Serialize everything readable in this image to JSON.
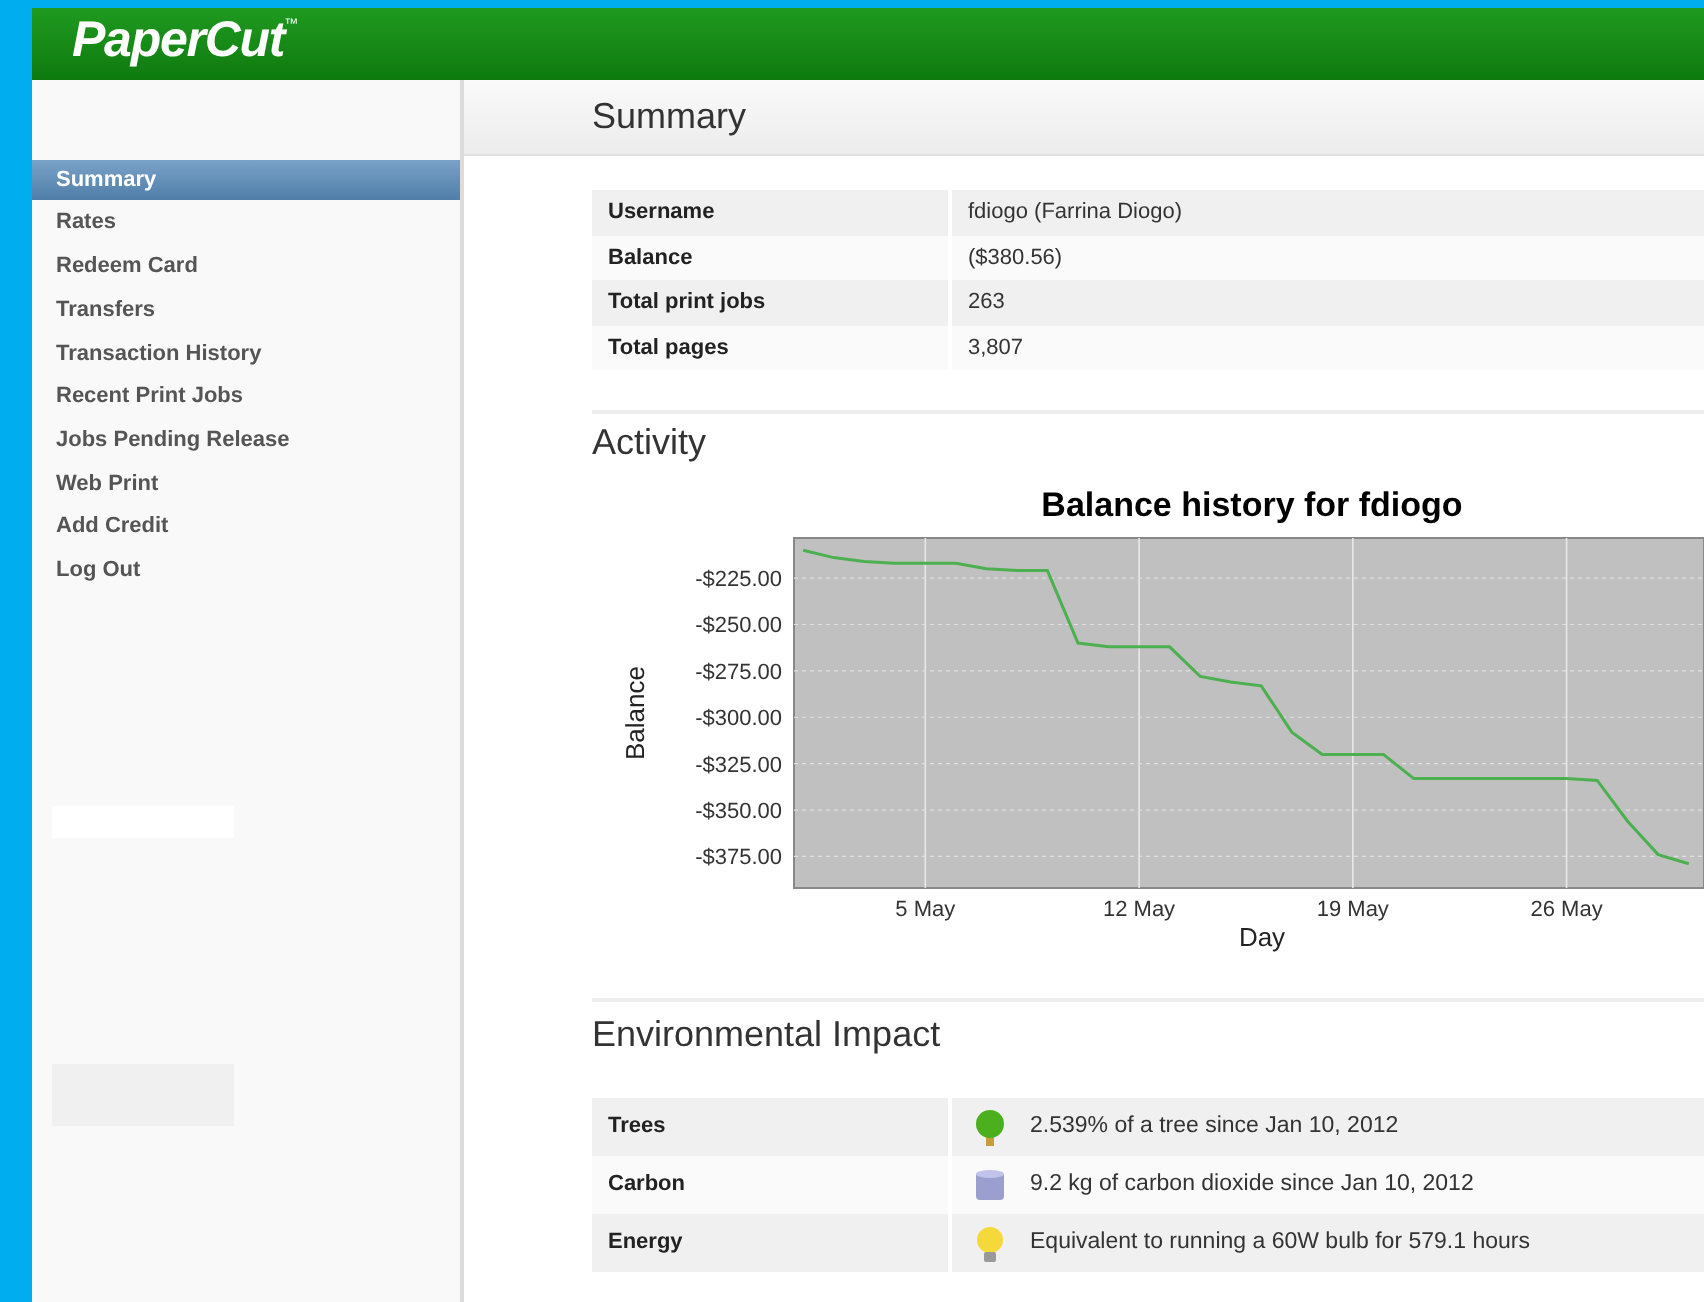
{
  "header": {
    "logo": "PaperCut",
    "trademark": "™"
  },
  "sidebar": {
    "items": [
      {
        "label": "Summary",
        "selected": true
      },
      {
        "label": "Rates",
        "selected": false
      },
      {
        "label": "Redeem Card",
        "selected": false
      },
      {
        "label": "Transfers",
        "selected": false
      },
      {
        "label": "Transaction History",
        "selected": false
      },
      {
        "label": "Recent Print Jobs",
        "selected": false
      },
      {
        "label": "Jobs Pending Release",
        "selected": false
      },
      {
        "label": "Web Print",
        "selected": false
      },
      {
        "label": "Add Credit",
        "selected": false
      },
      {
        "label": "Log Out",
        "selected": false
      }
    ]
  },
  "page_title": "Summary",
  "summary": [
    {
      "label": "Username",
      "value": "fdiogo (Farrina Diogo)"
    },
    {
      "label": "Balance",
      "value": "($380.56)"
    },
    {
      "label": "Total print jobs",
      "value": "263"
    },
    {
      "label": "Total pages",
      "value": "3,807"
    }
  ],
  "activity": {
    "heading": "Activity",
    "chart_data": {
      "type": "line",
      "grid": true,
      "title": "Balance history for fdiogo",
      "xlabel": "Day",
      "ylabel": "Balance",
      "ylim": [
        -392,
        -203.4
      ],
      "categories": [
        null,
        null,
        null,
        null,
        "5 May",
        null,
        null,
        null,
        null,
        null,
        null,
        "12 May",
        null,
        null,
        null,
        null,
        null,
        null,
        "19 May",
        null,
        null,
        null,
        null,
        null,
        null,
        "26 May",
        null,
        null,
        null,
        null
      ],
      "yticks": [
        {
          "value": -225,
          "label": "-$225.00"
        },
        {
          "value": -250,
          "label": "-$250.00"
        },
        {
          "value": -275,
          "label": "-$275.00"
        },
        {
          "value": -300,
          "label": "-$300.00"
        },
        {
          "value": -325,
          "label": "-$325.00"
        },
        {
          "value": -350,
          "label": "-$350.00"
        },
        {
          "value": -375,
          "label": "-$375.00"
        }
      ],
      "series": [
        {
          "color": "#4caf50",
          "values": [
            -210,
            -214,
            -216,
            -217,
            -217,
            -217,
            -220,
            -221,
            -221,
            -260,
            -262,
            -262,
            -262,
            -278,
            -281,
            -283,
            -308,
            -320,
            -320,
            -320,
            -333,
            -333,
            -333,
            -333,
            -333,
            -333,
            -334,
            -356,
            -374,
            -379
          ]
        }
      ]
    }
  },
  "environment": {
    "heading": "Environmental Impact",
    "rows": [
      {
        "kind": "tree",
        "label": "Trees",
        "value": "2.539% of a tree since Jan 10, 2012"
      },
      {
        "kind": "carbon",
        "label": "Carbon",
        "value": "9.2 kg of carbon dioxide since Jan 10, 2012"
      },
      {
        "kind": "energy",
        "label": "Energy",
        "value": "Equivalent to running a 60W bulb for 579.1 hours"
      }
    ]
  }
}
